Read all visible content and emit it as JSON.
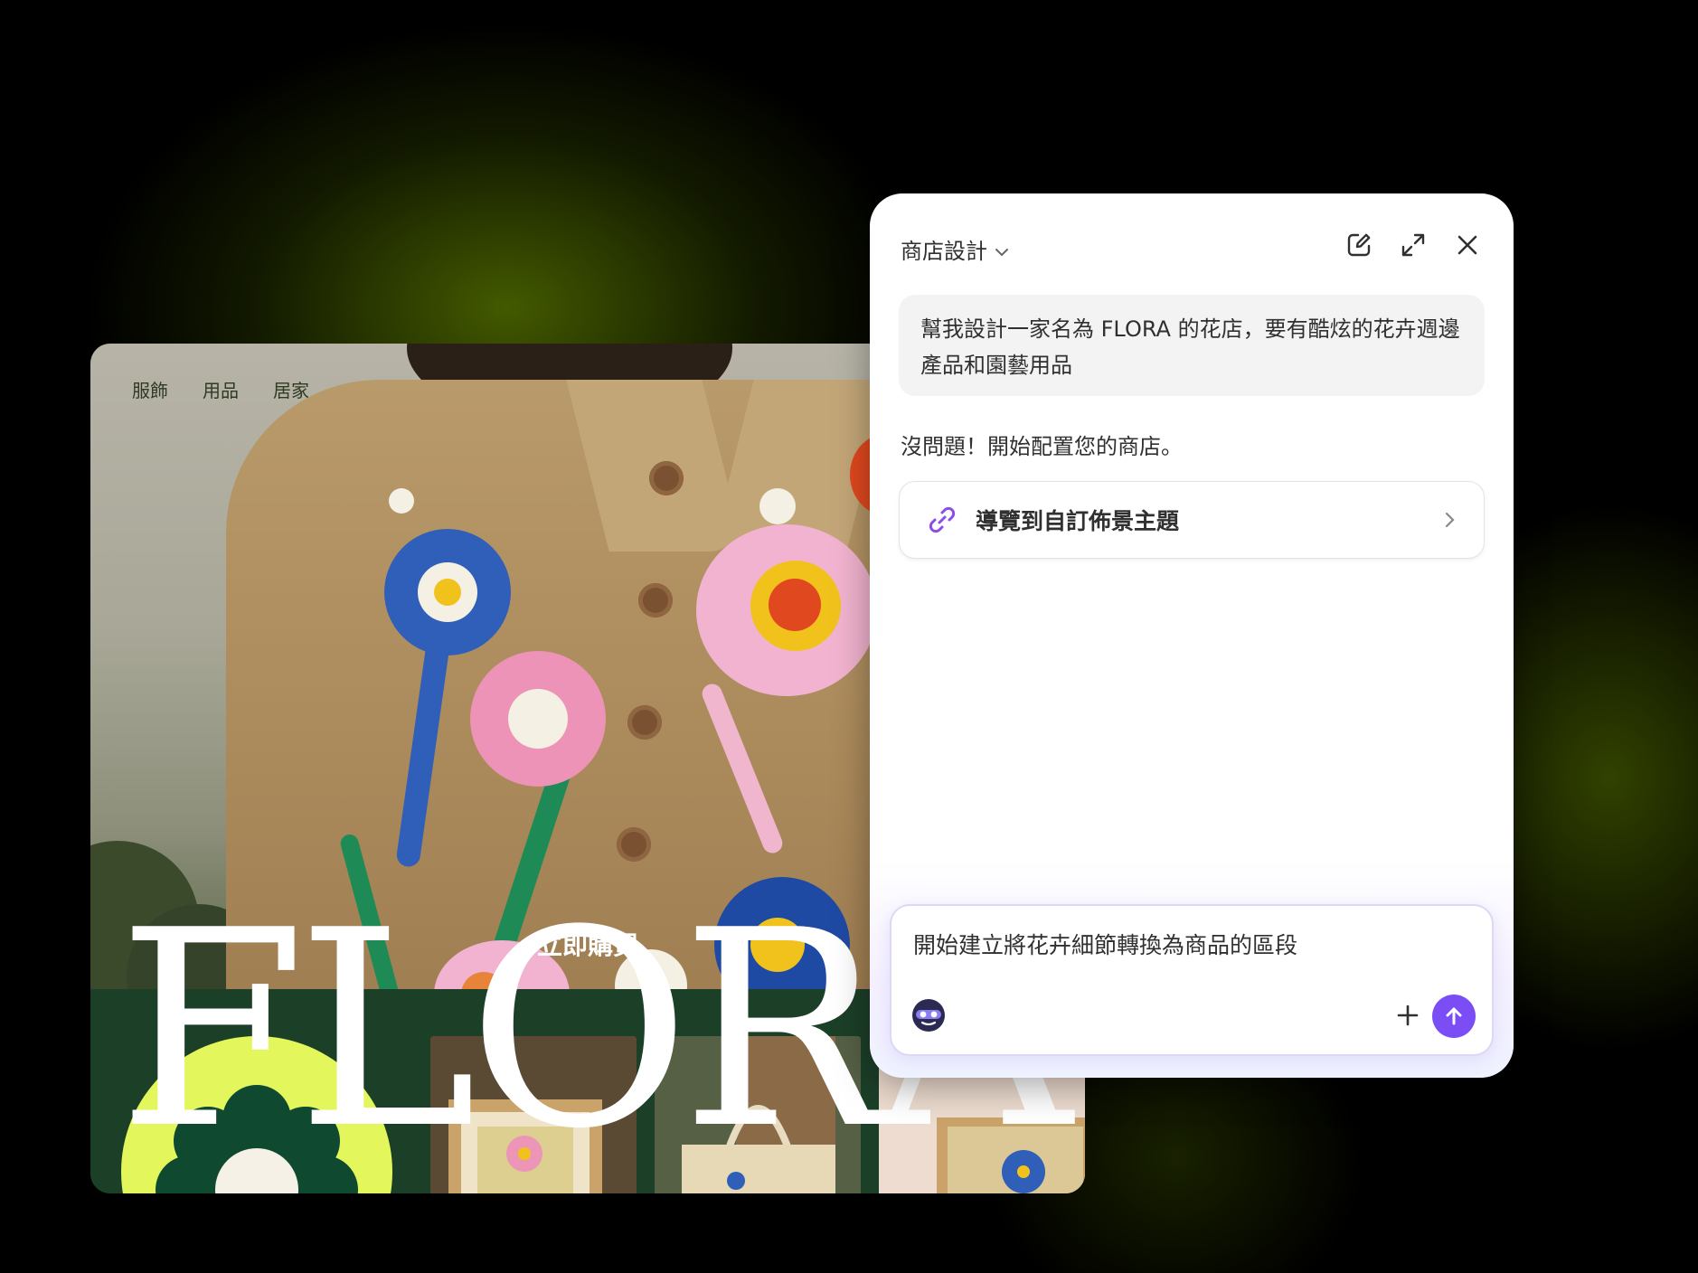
{
  "storefront": {
    "nav": [
      "服飾",
      "用品",
      "居家"
    ],
    "brand": "FLORA",
    "cta": "立即購買",
    "colors": {
      "hero_text": "#ffffff",
      "section_bg": "#1c3f28",
      "badge": "#e3f75d"
    }
  },
  "assistant": {
    "title": "商店設計",
    "icons": {
      "title_menu": "chevron-down-icon",
      "new_chat": "edit-icon",
      "expand": "expand-icon",
      "close": "close-icon"
    },
    "user_message": "幫我設計一家名為 FLORA 的花店，要有酷炫的花卉週邊產品和園藝用品",
    "reply": "沒問題！開始配置您的商店。",
    "action_card": {
      "label": "導覽到自訂佈景主題",
      "icon": "link-icon",
      "arrow": "chevron-right-icon"
    },
    "composer": {
      "text": "開始建立將花卉細節轉換為商品的區段",
      "add_icon": "plus-icon",
      "send_icon": "arrow-up-icon"
    },
    "colors": {
      "accent": "#7b4ef5",
      "text": "#303030",
      "bubble": "#f3f3f3"
    }
  }
}
